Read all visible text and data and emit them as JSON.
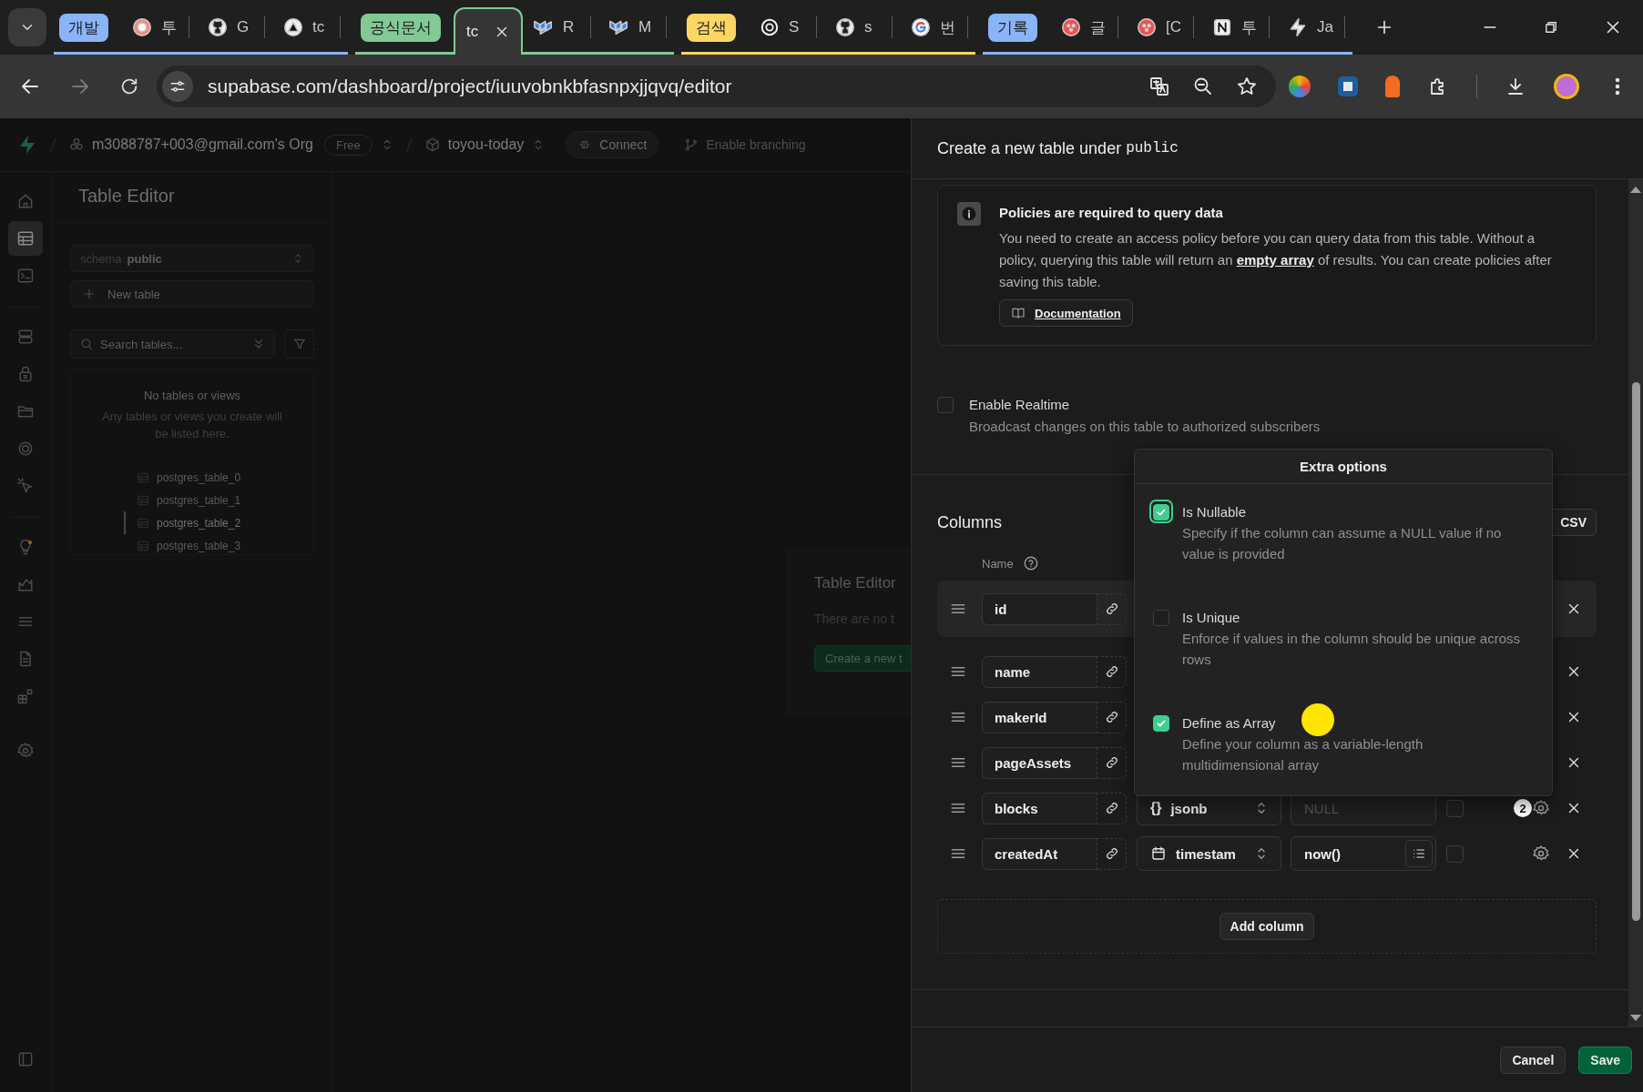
{
  "browser": {
    "tab_groups": [
      {
        "label": "개발",
        "color": "#8ab4f8",
        "tabs": [
          {
            "title": "투",
            "kind": "avatar",
            "selected": false
          },
          {
            "title": "G",
            "kind": "github",
            "selected": false
          },
          {
            "title": "tc",
            "kind": "triangle",
            "selected": false
          }
        ]
      },
      {
        "label": "공식문서",
        "color": "#81c995",
        "tabs": [
          {
            "title": "tc",
            "kind": "none",
            "selected": true
          },
          {
            "title": "R",
            "kind": "mui",
            "selected": false
          },
          {
            "title": "M",
            "kind": "mui",
            "selected": false
          }
        ]
      },
      {
        "label": "검색",
        "color": "#fdd663",
        "tabs": [
          {
            "title": "S",
            "kind": "openai",
            "selected": false
          },
          {
            "title": "s",
            "kind": "github",
            "selected": false
          },
          {
            "title": "번",
            "kind": "google",
            "selected": false
          }
        ]
      },
      {
        "label": "기록",
        "color": "#8ab4f8",
        "tabs": [
          {
            "title": "글",
            "kind": "red",
            "selected": false
          },
          {
            "title": "[C",
            "kind": "red",
            "selected": false
          },
          {
            "title": "투",
            "kind": "notion",
            "selected": false
          },
          {
            "title": "Ja",
            "kind": "bolt",
            "selected": false
          }
        ]
      }
    ],
    "url": "supabase.com/dashboard/project/iuuvobnkbfasnpxjjqvq/editor"
  },
  "top_bar": {
    "org": "m3088787+003@gmail.com's Org",
    "plan": "Free",
    "project": "toyou-today",
    "connect": "Connect",
    "branching": "Enable branching"
  },
  "sidebar_items": [
    {
      "selected": false
    },
    {
      "selected": true
    },
    {
      "selected": false
    },
    {
      "selected": false
    },
    {
      "selected": false
    },
    {
      "selected": false
    },
    {
      "selected": false
    },
    {
      "selected": false
    },
    {
      "selected": false
    },
    {
      "selected": false
    },
    {
      "selected": false
    },
    {
      "selected": false
    },
    {
      "selected": false
    },
    {
      "selected": false
    },
    {
      "selected": false
    }
  ],
  "table_panel": {
    "title": "Table Editor",
    "schema_label": "schema",
    "schema": "public",
    "new_table": "New table",
    "search": {
      "placeholder": "Search tables..."
    },
    "empty_title": "No tables or views",
    "empty_text": "Any tables or views you create will be listed here.",
    "preview": [
      {
        "label": "postgres_table_0",
        "selected": false
      },
      {
        "label": "postgres_table_1",
        "selected": false
      },
      {
        "label": "postgres_table_2",
        "selected": true
      },
      {
        "label": "postgres_table_3",
        "selected": false
      }
    ]
  },
  "main_card": {
    "title": "Table Editor",
    "text": "There are no t",
    "button": "Create a new t"
  },
  "panel": {
    "title": "Create a new table under ",
    "title_code": "public",
    "info": {
      "title": "Policies are required to query data",
      "text_before": "You need to create an access policy before you can query data from this table. Without a policy, querying this table will return an ",
      "link": "empty array",
      "text_after": " of results. You can create policies after saving this table.",
      "button": "Documentation"
    },
    "realtime": {
      "label": "Enable Realtime",
      "description": "Broadcast changes on this table to authorized subscribers",
      "checked": false
    },
    "columns": {
      "title": "Columns",
      "import_button": "CSV",
      "name_header": "Name",
      "rows": [
        {
          "name": "id",
          "selected": true
        },
        {
          "name": "name",
          "selected": false
        },
        {
          "name": "makerId",
          "selected": false
        },
        {
          "name": "pageAssets",
          "selected": false
        },
        {
          "name": "blocks",
          "selected": false,
          "type": {
            "kind": "json",
            "glyph": "{}",
            "label": "jsonb"
          },
          "default": {
            "placeholder": "NULL"
          },
          "checked": false,
          "badge": "2"
        },
        {
          "name": "createdAt",
          "selected": false,
          "type": {
            "kind": "date",
            "label": "timestam"
          },
          "default": {
            "value": "now()",
            "has_menu": true
          },
          "checked": false
        }
      ],
      "add_button": "Add column"
    },
    "extra_options": {
      "title": "Extra options",
      "options": [
        {
          "label": "Is Nullable",
          "description": "Specify if the column can assume a NULL value if no value is provided",
          "checked": true,
          "focused": true
        },
        {
          "label": "Is Unique",
          "description": "Enforce if values in the column should be unique across rows",
          "checked": false,
          "focused": false
        },
        {
          "label": "Define as Array",
          "description": "Define your column as a variable-length multidimensional array",
          "checked": true,
          "focused": false
        }
      ]
    },
    "footer": {
      "cancel": "Cancel",
      "save": "Save"
    }
  }
}
